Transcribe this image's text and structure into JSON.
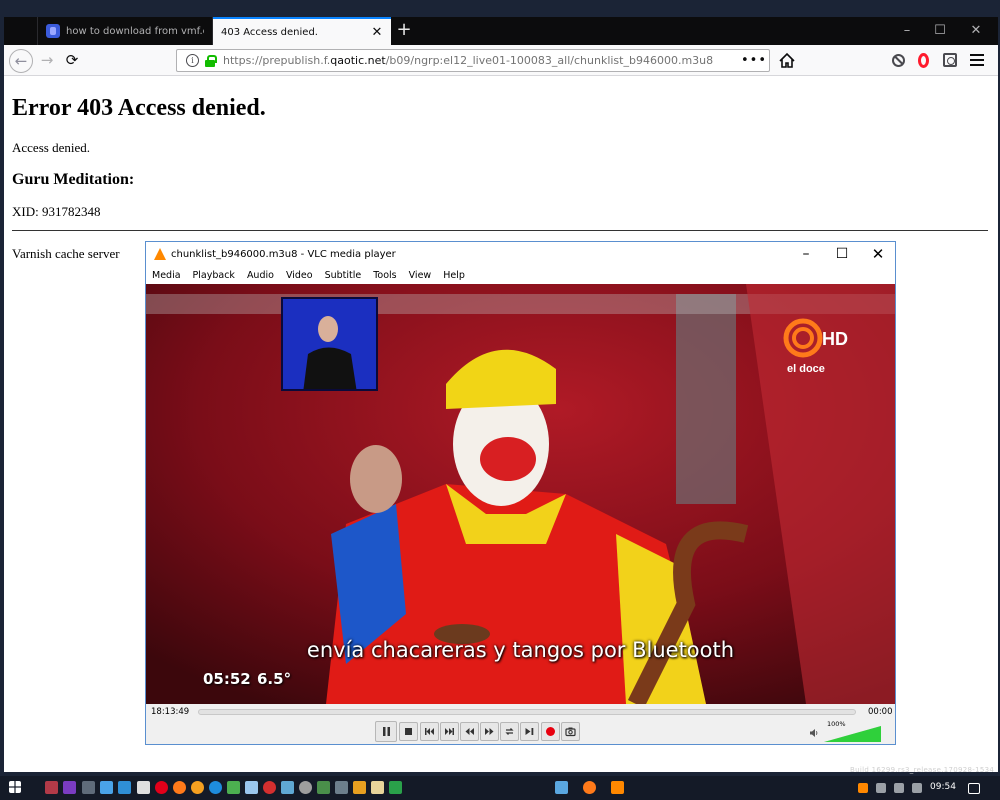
{
  "firefox": {
    "tabs": [
      {
        "label": "how to download from vmf.ed",
        "active": false
      },
      {
        "label": "403 Access denied.",
        "active": true
      }
    ],
    "new_tab_label": "+",
    "window_controls": {
      "minimize": "–",
      "maximize": "☐",
      "close": "✕"
    },
    "url": {
      "prefix": "https://prepublish.f.",
      "domain": "qaotic.net",
      "path": "/b09/ngrp:el12_live01-100083_all/chunklist_b946000.m3u8"
    },
    "page_actions": "•••"
  },
  "page": {
    "heading": "Error 403 Access denied.",
    "paragraph": "Access denied.",
    "subheading": "Guru Meditation:",
    "xid": "XID: 931782348",
    "footer": "Varnish cache server"
  },
  "vlc": {
    "title": "chunklist_b946000.m3u8 - VLC media player",
    "menu": [
      "Media",
      "Playback",
      "Audio",
      "Video",
      "Subtitle",
      "Tools",
      "View",
      "Help"
    ],
    "video": {
      "channel_logo_text": "HD",
      "channel_name": "el doce",
      "subtitle": "envía chacareras y tangos por Bluetooth",
      "overlay_time": "05:52",
      "overlay_temp": "6.5°"
    },
    "elapsed": "18:13:49",
    "total": "00:00",
    "seek_progress": 0.0,
    "volume": "100%",
    "volume_level": 1.0
  },
  "taskbar": {
    "clock": "09:54",
    "build_overlay": "Build 16299.rs3_release.170928-1534"
  },
  "colors": {
    "accent": "#0a84ff",
    "lock": "#12bc00",
    "vlc_orange": "#ff8800",
    "record": "#e8000f",
    "volume_green": "#2fd03b"
  }
}
